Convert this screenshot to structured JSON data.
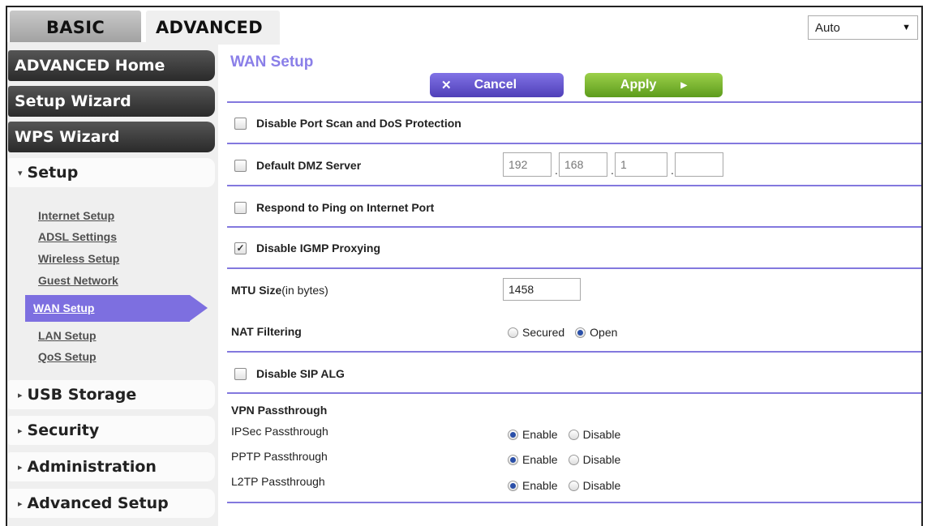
{
  "tabs": {
    "basic": "BASIC",
    "advanced": "ADVANCED"
  },
  "language": {
    "selected": "Auto"
  },
  "sidebar": {
    "advanced_home": "ADVANCED Home",
    "setup_wizard": "Setup Wizard",
    "wps_wizard": "WPS Wizard",
    "setup": "Setup",
    "setup_items": [
      "Internet Setup",
      "ADSL Settings",
      "Wireless Setup",
      "Guest Network",
      "WAN Setup",
      "LAN Setup",
      "QoS Setup"
    ],
    "usb_storage": "USB Storage",
    "security": "Security",
    "administration": "Administration",
    "advanced_setup": "Advanced Setup"
  },
  "main": {
    "title": "WAN Setup",
    "cancel_label": "Cancel",
    "apply_label": "Apply",
    "disable_port_scan": {
      "label": "Disable Port Scan and DoS Protection",
      "checked": false
    },
    "default_dmz": {
      "label": "Default DMZ Server",
      "checked": false,
      "ip": [
        "192",
        "168",
        "1",
        ""
      ]
    },
    "respond_ping": {
      "label": "Respond to Ping on Internet Port",
      "checked": false
    },
    "disable_igmp": {
      "label": "Disable IGMP Proxying",
      "checked": true
    },
    "mtu": {
      "label": "MTU Size",
      "unit": "(in bytes)",
      "value": "1458"
    },
    "nat": {
      "label": "NAT Filtering",
      "options": [
        "Secured",
        "Open"
      ],
      "selected": "Open"
    },
    "disable_sip": {
      "label": "Disable SIP ALG",
      "checked": false
    },
    "vpn": {
      "title": "VPN Passthrough",
      "ipsec": "IPSec Passthrough",
      "pptp": "PPTP Passthrough",
      "l2tp": "L2TP Passthrough",
      "enable": "Enable",
      "disable": "Disable",
      "selected": [
        "Enable",
        "Enable",
        "Enable"
      ]
    }
  },
  "colors": {
    "accent": "#8378de",
    "apply": "#6fae24",
    "sidebar_bg": "#efefef"
  }
}
